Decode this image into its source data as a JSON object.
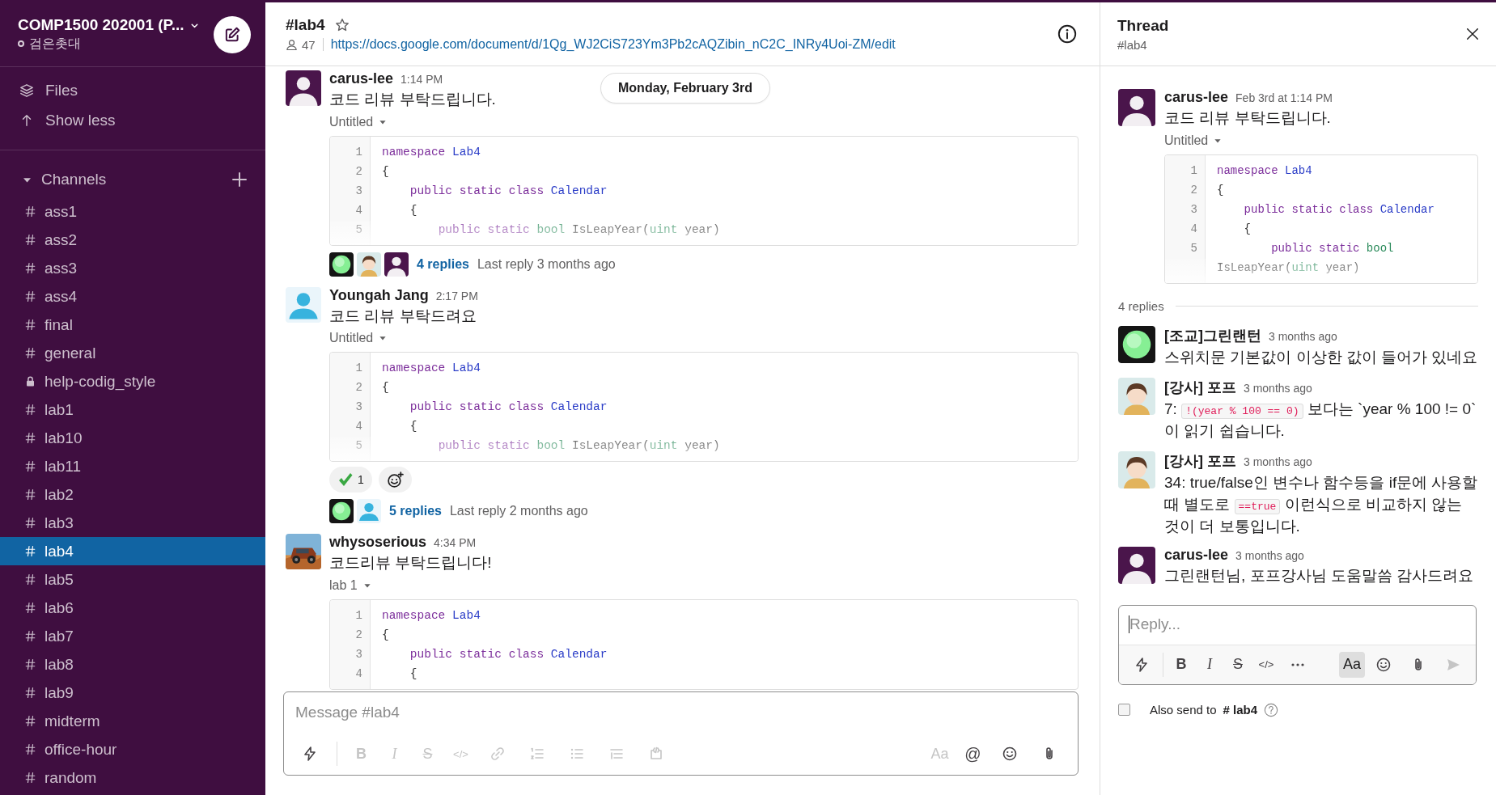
{
  "workspace": {
    "name": "COMP1500 202001 (P...",
    "user": "검은촛대",
    "online": false
  },
  "sidebar": {
    "nav": [
      {
        "label": "Files"
      },
      {
        "label": "Show less"
      }
    ],
    "channels_header": {
      "label": "Channels",
      "expanded": true
    },
    "channels": [
      {
        "name": "ass1",
        "private": false,
        "selected": false
      },
      {
        "name": "ass2",
        "private": false,
        "selected": false
      },
      {
        "name": "ass3",
        "private": false,
        "selected": false
      },
      {
        "name": "ass4",
        "private": false,
        "selected": false
      },
      {
        "name": "final",
        "private": false,
        "selected": false
      },
      {
        "name": "general",
        "private": false,
        "selected": false
      },
      {
        "name": "help-codig_style",
        "private": true,
        "selected": false
      },
      {
        "name": "lab1",
        "private": false,
        "selected": false
      },
      {
        "name": "lab10",
        "private": false,
        "selected": false
      },
      {
        "name": "lab11",
        "private": false,
        "selected": false
      },
      {
        "name": "lab2",
        "private": false,
        "selected": false
      },
      {
        "name": "lab3",
        "private": false,
        "selected": false
      },
      {
        "name": "lab4",
        "private": false,
        "selected": true
      },
      {
        "name": "lab5",
        "private": false,
        "selected": false
      },
      {
        "name": "lab6",
        "private": false,
        "selected": false
      },
      {
        "name": "lab7",
        "private": false,
        "selected": false
      },
      {
        "name": "lab8",
        "private": false,
        "selected": false
      },
      {
        "name": "lab9",
        "private": false,
        "selected": false
      },
      {
        "name": "midterm",
        "private": false,
        "selected": false
      },
      {
        "name": "office-hour",
        "private": false,
        "selected": false
      },
      {
        "name": "random",
        "private": false,
        "selected": false
      }
    ]
  },
  "channel": {
    "name": "#lab4",
    "starred": false,
    "members": "47",
    "topic": "https://docs.google.com/document/d/1Qg_WJ2CiS723Ym3Pb2cAQZibin_nC2C_INRy4Uoi-ZM/edit"
  },
  "date_divider": "Monday, February 3rd",
  "messages": [
    {
      "author": "carus-lee",
      "avatar": {
        "kind": "person-purple"
      },
      "time": "1:14 PM",
      "text": "코드 리뷰 부탁드립니다.",
      "file": {
        "title": "Untitled",
        "collapsed": true,
        "lines": [
          {
            "n": "1",
            "tokens": [
              {
                "text": "namespace",
                "kind": "keyword"
              },
              {
                "text": " Lab4",
                "kind": "type"
              }
            ]
          },
          {
            "n": "2",
            "tokens": [
              {
                "text": "{",
                "kind": "plain"
              }
            ]
          },
          {
            "n": "3",
            "tokens": [
              {
                "text": "    public static class",
                "kind": "keyword"
              },
              {
                "text": " Calendar",
                "kind": "type"
              }
            ]
          },
          {
            "n": "4",
            "tokens": [
              {
                "text": "    {",
                "kind": "plain"
              }
            ]
          },
          {
            "n": "5",
            "tokens": [
              {
                "text": "        public static",
                "kind": "keyword"
              },
              {
                "text": " bool",
                "kind": "builtin"
              },
              {
                "text": " IsLeapYear(",
                "kind": "plain"
              },
              {
                "text": "uint",
                "kind": "builtin"
              },
              {
                "text": " year)",
                "kind": "plain"
              }
            ]
          }
        ]
      },
      "thread": {
        "avatars": [
          {
            "kind": "green-face"
          },
          {
            "kind": "person-drawing"
          },
          {
            "kind": "person-purple"
          }
        ],
        "replies": "4 replies",
        "last": "Last reply 3 months ago"
      }
    },
    {
      "author": "Youngah Jang",
      "avatar": {
        "kind": "person-blue"
      },
      "time": "2:17 PM",
      "text": "코드 리뷰 부탁드려요",
      "file": {
        "title": "Untitled",
        "collapsed": true,
        "lines": [
          {
            "n": "1",
            "tokens": [
              {
                "text": "namespace",
                "kind": "keyword"
              },
              {
                "text": " Lab4",
                "kind": "type"
              }
            ]
          },
          {
            "n": "2",
            "tokens": [
              {
                "text": "{",
                "kind": "plain"
              }
            ]
          },
          {
            "n": "3",
            "tokens": [
              {
                "text": "    public static class",
                "kind": "keyword"
              },
              {
                "text": " Calendar",
                "kind": "type"
              }
            ]
          },
          {
            "n": "4",
            "tokens": [
              {
                "text": "    {",
                "kind": "plain"
              }
            ]
          },
          {
            "n": "5",
            "tokens": [
              {
                "text": "        public static",
                "kind": "keyword"
              },
              {
                "text": " bool",
                "kind": "builtin"
              },
              {
                "text": " IsLeapYear(",
                "kind": "plain"
              },
              {
                "text": "uint",
                "kind": "builtin"
              },
              {
                "text": " year)",
                "kind": "plain"
              }
            ]
          }
        ]
      },
      "reactions": [
        {
          "kind": "check",
          "count": "1"
        }
      ],
      "thread": {
        "avatars": [
          {
            "kind": "green-face"
          },
          {
            "kind": "person-blue"
          }
        ],
        "replies": "5 replies",
        "last": "Last reply 2 months ago"
      }
    },
    {
      "author": "whysoserious",
      "time": "4:34 PM",
      "text": "코드리뷰 부탁드립니다!",
      "file": {
        "title": "lab 1",
        "lines": [
          {
            "n": "1",
            "tokens": [
              {
                "text": "namespace",
                "kind": "keyword"
              },
              {
                "text": " Lab4",
                "kind": "type"
              }
            ]
          },
          {
            "n": "2",
            "tokens": [
              {
                "text": "{",
                "kind": "plain"
              }
            ]
          },
          {
            "n": "3",
            "tokens": [
              {
                "text": "    public static class",
                "kind": "keyword"
              },
              {
                "text": " Calendar",
                "kind": "type"
              }
            ]
          },
          {
            "n": "4",
            "tokens": [
              {
                "text": "    {",
                "kind": "plain"
              }
            ]
          }
        ]
      }
    }
  ],
  "composer": {
    "placeholder": "Message #lab4",
    "tools_left": [
      {
        "kind": "bolt",
        "disabled": false
      },
      {
        "kind": "bold",
        "label": "B",
        "disabled": true
      },
      {
        "kind": "italic",
        "label": "I",
        "disabled": true
      },
      {
        "kind": "strike",
        "label": "S",
        "disabled": true
      },
      {
        "kind": "code",
        "label": "</>",
        "disabled": true
      },
      {
        "kind": "link",
        "disabled": true
      },
      {
        "kind": "ol",
        "disabled": true
      },
      {
        "kind": "ul",
        "disabled": true
      },
      {
        "kind": "quote",
        "disabled": true
      },
      {
        "kind": "codeblock",
        "disabled": true
      }
    ],
    "tools_right": [
      {
        "kind": "format",
        "label": "Aa",
        "disabled": true,
        "selected": false
      },
      {
        "kind": "mention",
        "label": "@",
        "disabled": false
      },
      {
        "kind": "emoji",
        "disabled": false
      },
      {
        "kind": "attach",
        "disabled": false
      }
    ]
  },
  "thread": {
    "title": "Thread",
    "channel": "#lab4",
    "root": {
      "author": "carus-lee",
      "avatar": {
        "kind": "person-purple"
      },
      "time": "Feb 3rd at 1:14 PM",
      "text": "코드 리뷰 부탁드립니다.",
      "file": {
        "title": "Untitled",
        "collapsed": true,
        "lines": [
          {
            "n": "1",
            "tokens": [
              {
                "text": "namespace",
                "kind": "keyword"
              },
              {
                "text": " Lab4",
                "kind": "type"
              }
            ]
          },
          {
            "n": "2",
            "tokens": [
              {
                "text": "{",
                "kind": "plain"
              }
            ]
          },
          {
            "n": "3",
            "tokens": [
              {
                "text": "    public static class",
                "kind": "keyword"
              },
              {
                "text": " Calendar",
                "kind": "type"
              }
            ]
          },
          {
            "n": "4",
            "tokens": [
              {
                "text": "    {",
                "kind": "plain"
              }
            ]
          },
          {
            "n": "5",
            "tokens": [
              {
                "text": "        public static",
                "kind": "keyword"
              },
              {
                "text": " bool",
                "kind": "builtin"
              },
              {
                "text": " IsLeapYear(",
                "kind": "plain"
              },
              {
                "text": "uint",
                "kind": "builtin"
              },
              {
                "text": " year)",
                "kind": "plain"
              }
            ]
          }
        ]
      }
    },
    "reply_count": "4 replies",
    "replies": [
      {
        "author": "[조교]그린랜턴",
        "avatar": {
          "kind": "green-face"
        },
        "time": "3 months ago",
        "body": [
          {
            "kind": "text",
            "text": "스위치문 기본값이 이상한 값이 들어가 있네요"
          }
        ]
      },
      {
        "author": "[강사] 포프",
        "avatar": {
          "kind": "person-drawing"
        },
        "time": "3 months ago",
        "body": [
          {
            "kind": "text",
            "text": "7: "
          },
          {
            "kind": "code",
            "text": "!(year % 100 == 0)"
          },
          {
            "kind": "text",
            "text": " 보다는 `year % 100 != 0`이 읽기 쉽습니다."
          }
        ]
      },
      {
        "author": "[강사] 포프",
        "avatar": {
          "kind": "person-drawing"
        },
        "time": "3 months ago",
        "body": [
          {
            "kind": "text",
            "text": "34: true/false인 변수나 함수등을 if문에 사용할 때 별도로 "
          },
          {
            "kind": "code",
            "text": "==true"
          },
          {
            "kind": "text",
            "text": " 이런식으로 비교하지 않는 것이 더 보통입니다."
          }
        ]
      },
      {
        "author": "carus-lee",
        "avatar": {
          "kind": "person-purple"
        },
        "time": "3 months ago",
        "body": [
          {
            "kind": "text",
            "text": "그린랜턴님, 포프강사님 도움말씀 감사드려요"
          }
        ]
      }
    ],
    "reply_box": {
      "placeholder": "Reply...",
      "tools_left": [
        {
          "kind": "bolt",
          "disabled": false
        },
        {
          "kind": "bold",
          "label": "B",
          "disabled": false
        },
        {
          "kind": "italic",
          "label": "I",
          "disabled": false
        },
        {
          "kind": "strike",
          "label": "S",
          "disabled": false
        },
        {
          "kind": "code",
          "label": "</>",
          "disabled": false
        },
        {
          "kind": "more",
          "disabled": false
        }
      ],
      "tools_right": [
        {
          "kind": "format",
          "label": "Aa",
          "disabled": false,
          "selected": true
        },
        {
          "kind": "emoji",
          "disabled": false
        },
        {
          "kind": "attach",
          "disabled": false
        },
        {
          "kind": "send",
          "disabled": true
        }
      ]
    },
    "also_send": {
      "checked": false,
      "label": "Also send to",
      "channel": "# lab4"
    }
  }
}
